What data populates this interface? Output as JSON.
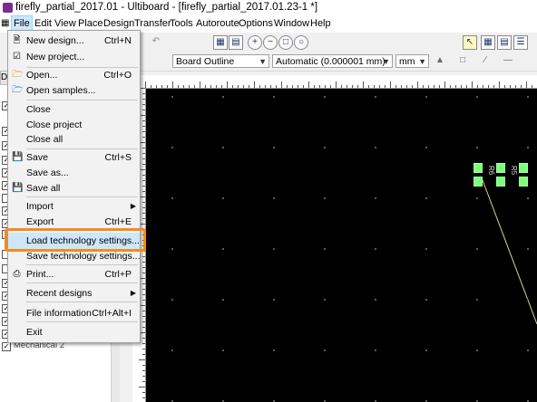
{
  "window": {
    "title": "firefly_partial_2017.01 - Ultiboard - [firefly_partial_2017.01.23-1 *]"
  },
  "menubar": {
    "items": [
      "File",
      "Edit",
      "View",
      "Place",
      "Design",
      "Transfer",
      "Tools",
      "Autoroute",
      "Options",
      "Window",
      "Help"
    ]
  },
  "toolbar": {
    "layer_combo": "Board Outline",
    "precision_combo": "Automatic (0.000001 mm)",
    "unit_combo": "mm"
  },
  "left_panel": {
    "tab_label": "De",
    "bottom_item": "Mechanical 2"
  },
  "file_menu": {
    "new_design": {
      "label": "New design...",
      "shortcut": "Ctrl+N"
    },
    "new_project": {
      "label": "New project..."
    },
    "open": {
      "label": "Open...",
      "shortcut": "Ctrl+O"
    },
    "open_samples": {
      "label": "Open samples..."
    },
    "close": {
      "label": "Close"
    },
    "close_project": {
      "label": "Close project"
    },
    "close_all": {
      "label": "Close all"
    },
    "save": {
      "label": "Save",
      "shortcut": "Ctrl+S"
    },
    "save_as": {
      "label": "Save as..."
    },
    "save_all": {
      "label": "Save all"
    },
    "import": {
      "label": "Import"
    },
    "export": {
      "label": "Export",
      "shortcut": "Ctrl+E"
    },
    "load_tech": {
      "label": "Load technology settings..."
    },
    "save_tech": {
      "label": "Save technology settings..."
    },
    "print": {
      "label": "Print...",
      "shortcut": "Ctrl+P"
    },
    "recent": {
      "label": "Recent designs"
    },
    "file_info": {
      "label": "File information",
      "shortcut": "Ctrl+Alt+I"
    },
    "exit": {
      "label": "Exit"
    }
  },
  "canvas": {
    "part_labels": [
      "R6",
      "R5"
    ]
  },
  "colors": {
    "highlight": "#f28c1e",
    "pads": "#7dff7d",
    "trace": "#d8d88a",
    "canvas": "#000000"
  }
}
